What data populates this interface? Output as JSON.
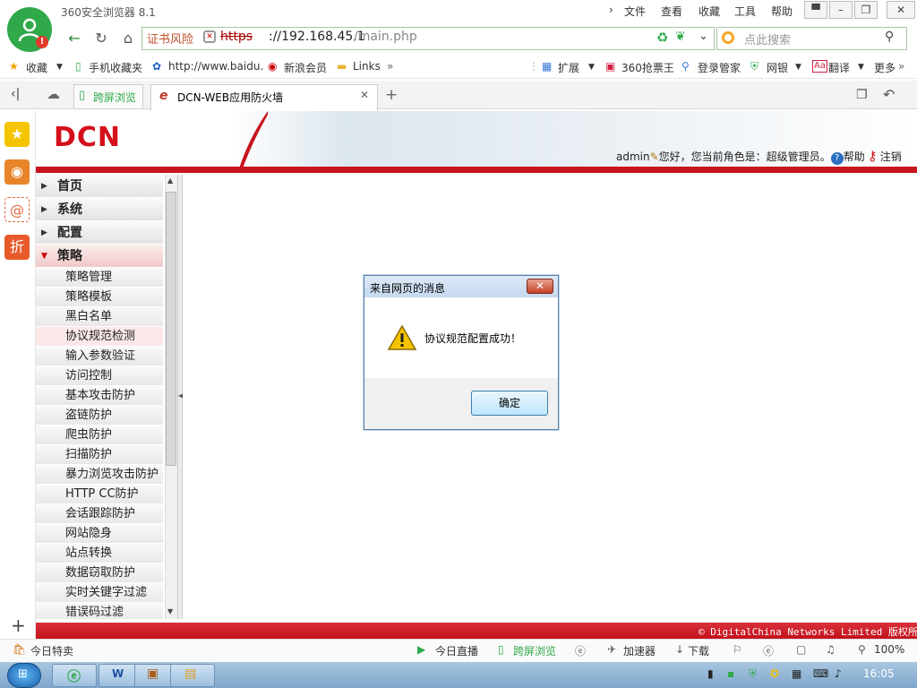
{
  "browser": {
    "app_title": "360安全浏览器 8.1",
    "menu": [
      "文件",
      "查看",
      "收藏",
      "工具",
      "帮助"
    ],
    "url_cert_warning": "证书风险",
    "url_scheme": "https",
    "url_host": "://192.168.45.1",
    "url_path": "/main.php",
    "search_placeholder": "点此搜索"
  },
  "favorites": {
    "left": [
      "收藏",
      "手机收藏夹",
      "http://www.baidu.",
      "新浪会员",
      "Links"
    ],
    "right": [
      "扩展",
      "360抢票王",
      "登录管家",
      "网银",
      "翻译",
      "更多"
    ]
  },
  "tabs": {
    "sync_label": "跨屏浏览",
    "active_title": "DCN-WEB应用防火墙"
  },
  "header": {
    "brand": "DCN",
    "user": "admin",
    "greeting": "您好，您当前角色是：超级管理员。",
    "help": "帮助",
    "logout": "注销"
  },
  "menu": {
    "groups": [
      "首页",
      "系统",
      "配置",
      "策略"
    ],
    "items": [
      "策略管理",
      "策略模板",
      "黑白名单",
      "协议规范检测",
      "输入参数验证",
      "访问控制",
      "基本攻击防护",
      "盗链防护",
      "爬虫防护",
      "扫描防护",
      "暴力浏览攻击防护",
      "HTTP CC防护",
      "会话跟踪防护",
      "网站隐身",
      "站点转换",
      "数据窃取防护",
      "实时关键字过滤",
      "错误码过滤"
    ]
  },
  "footer": {
    "copyright": "© DigitalChina Networks Limited 版权所有"
  },
  "statusbar": {
    "left": "今日特卖",
    "live": "今日直播",
    "sync": "跨屏浏览",
    "accelerator": "加速器",
    "download": "下载",
    "zoom": "100%"
  },
  "taskbar": {
    "clock": "16:05"
  },
  "dialog": {
    "title": "来自网页的消息",
    "message": "协议规范配置成功！",
    "ok": "确定"
  },
  "colors": {
    "brand_red": "#c8141e",
    "browser_green": "#2fa94a"
  }
}
